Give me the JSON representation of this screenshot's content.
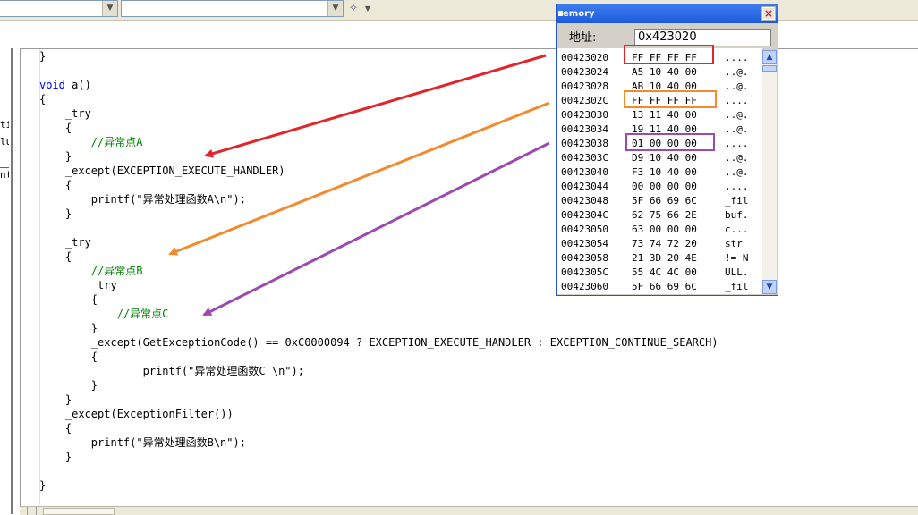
{
  "toolbar": {
    "combo1": "",
    "combo2": "",
    "wand_icon": "magic-wand-icon"
  },
  "left_panel": {
    "tab_fragments": [
      "ti",
      "lu",
      "nt"
    ]
  },
  "code_lines": [
    {
      "parts": [
        {
          "t": "}",
          "c": ""
        }
      ]
    },
    {
      "parts": [
        {
          "t": "",
          "c": ""
        }
      ]
    },
    {
      "parts": [
        {
          "t": "void",
          "c": "kw"
        },
        {
          "t": " a()",
          "c": ""
        }
      ]
    },
    {
      "parts": [
        {
          "t": "{",
          "c": ""
        }
      ]
    },
    {
      "parts": [
        {
          "t": "    _try",
          "c": ""
        }
      ]
    },
    {
      "parts": [
        {
          "t": "    {",
          "c": ""
        }
      ]
    },
    {
      "parts": [
        {
          "t": "        ",
          "c": ""
        },
        {
          "t": "//异常点A",
          "c": "cm"
        }
      ]
    },
    {
      "parts": [
        {
          "t": "    }",
          "c": ""
        }
      ]
    },
    {
      "parts": [
        {
          "t": "    _except(EXCEPTION_EXECUTE_HANDLER)",
          "c": ""
        }
      ]
    },
    {
      "parts": [
        {
          "t": "    {",
          "c": ""
        }
      ]
    },
    {
      "parts": [
        {
          "t": "        printf(\"异常处理函数A\\n\");",
          "c": ""
        }
      ]
    },
    {
      "parts": [
        {
          "t": "    }",
          "c": ""
        }
      ]
    },
    {
      "parts": [
        {
          "t": "",
          "c": ""
        }
      ]
    },
    {
      "parts": [
        {
          "t": "    _try",
          "c": ""
        }
      ]
    },
    {
      "parts": [
        {
          "t": "    {",
          "c": ""
        }
      ]
    },
    {
      "parts": [
        {
          "t": "        ",
          "c": ""
        },
        {
          "t": "//异常点B",
          "c": "cm"
        }
      ]
    },
    {
      "parts": [
        {
          "t": "        _try",
          "c": ""
        }
      ]
    },
    {
      "parts": [
        {
          "t": "        {",
          "c": ""
        }
      ]
    },
    {
      "parts": [
        {
          "t": "            ",
          "c": ""
        },
        {
          "t": "//异常点C",
          "c": "cm"
        }
      ]
    },
    {
      "parts": [
        {
          "t": "        }",
          "c": ""
        }
      ]
    },
    {
      "parts": [
        {
          "t": "        _except(GetExceptionCode() == 0xC0000094 ? EXCEPTION_EXECUTE_HANDLER : EXCEPTION_CONTINUE_SEARCH)",
          "c": ""
        }
      ]
    },
    {
      "parts": [
        {
          "t": "        {",
          "c": ""
        }
      ]
    },
    {
      "parts": [
        {
          "t": "                printf(\"异常处理函数C \\n\");",
          "c": ""
        }
      ]
    },
    {
      "parts": [
        {
          "t": "        }",
          "c": ""
        }
      ]
    },
    {
      "parts": [
        {
          "t": "    }",
          "c": ""
        }
      ]
    },
    {
      "parts": [
        {
          "t": "    _except(ExceptionFilter())",
          "c": ""
        }
      ]
    },
    {
      "parts": [
        {
          "t": "    {",
          "c": ""
        }
      ]
    },
    {
      "parts": [
        {
          "t": "        printf(\"异常处理函数B\\n\");",
          "c": ""
        }
      ]
    },
    {
      "parts": [
        {
          "t": "    }",
          "c": ""
        }
      ]
    },
    {
      "parts": [
        {
          "t": "",
          "c": ""
        }
      ]
    },
    {
      "parts": [
        {
          "t": "}",
          "c": ""
        }
      ]
    }
  ],
  "memory_window": {
    "title": "emory",
    "close_label": "×",
    "address_label": "地址:",
    "address_value": "0x423020",
    "rows": [
      {
        "addr": "00423020",
        "bytes": "FF FF FF FF",
        "ascii": "...."
      },
      {
        "addr": "00423024",
        "bytes": "A5 10 40 00",
        "ascii": "..@."
      },
      {
        "addr": "00423028",
        "bytes": "AB 10 40 00",
        "ascii": "..@."
      },
      {
        "addr": "0042302C",
        "bytes": "FF FF FF FF",
        "ascii": "...."
      },
      {
        "addr": "00423030",
        "bytes": "13 11 40 00",
        "ascii": "..@."
      },
      {
        "addr": "00423034",
        "bytes": "19 11 40 00",
        "ascii": "..@."
      },
      {
        "addr": "00423038",
        "bytes": "01 00 00 00",
        "ascii": "...."
      },
      {
        "addr": "0042303C",
        "bytes": "D9 10 40 00",
        "ascii": "..@."
      },
      {
        "addr": "00423040",
        "bytes": "F3 10 40 00",
        "ascii": "..@."
      },
      {
        "addr": "00423044",
        "bytes": "00 00 00 00",
        "ascii": "...."
      },
      {
        "addr": "00423048",
        "bytes": "5F 66 69 6C",
        "ascii": "_fil"
      },
      {
        "addr": "0042304C",
        "bytes": "62 75 66 2E",
        "ascii": "buf."
      },
      {
        "addr": "00423050",
        "bytes": "63 00 00 00",
        "ascii": "c..."
      },
      {
        "addr": "00423054",
        "bytes": "73 74 72 20",
        "ascii": "str "
      },
      {
        "addr": "00423058",
        "bytes": "21 3D 20 4E",
        "ascii": "!= N"
      },
      {
        "addr": "0042305C",
        "bytes": "55 4C 4C 00",
        "ascii": "ULL."
      },
      {
        "addr": "00423060",
        "bytes": "5F 66 69 6C",
        "ascii": "_fil"
      }
    ],
    "scroll_up_icon": "scroll-up-icon",
    "scroll_down_icon": "scroll-down-icon"
  },
  "annotations": [
    {
      "name": "red-arrow-to-exception-point-a",
      "color": "#e3242b"
    },
    {
      "name": "orange-arrow-to-exception-point-b",
      "color": "#f28a2e"
    },
    {
      "name": "purple-arrow-to-exception-point-c",
      "color": "#9b4bb0"
    }
  ]
}
